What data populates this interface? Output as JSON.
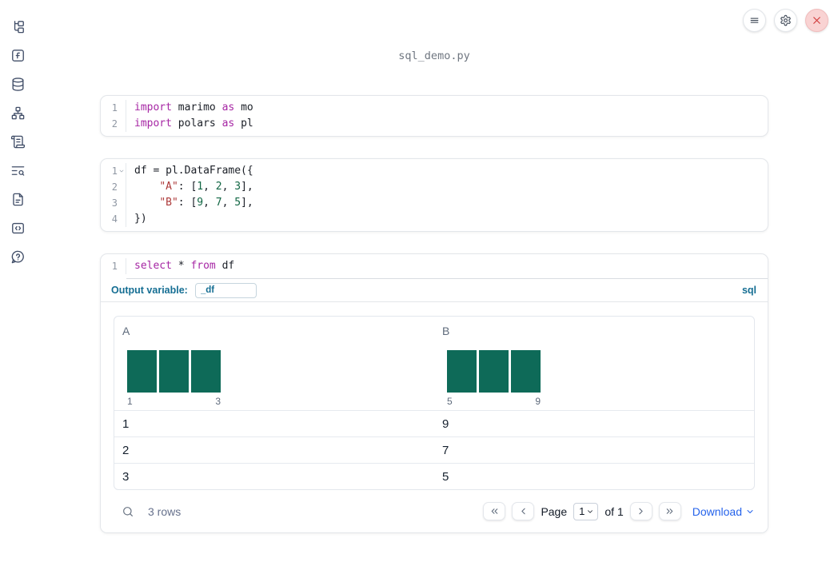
{
  "notebook": {
    "title": "sql_demo.py"
  },
  "colors": {
    "accent_blue": "#156e93",
    "link_blue": "#2563eb",
    "bar_teal": "#0e6a58",
    "keyword_purple": "#a626a4",
    "string_red": "#ad3a3a",
    "number_green": "#116644",
    "close_red": "#d03a3a"
  },
  "sidebar": {
    "icons": [
      "file-tree",
      "function-square",
      "database",
      "dependency-graph",
      "scroll-logs",
      "text-search",
      "document",
      "code-snippets",
      "help-chat"
    ]
  },
  "top_actions": {
    "icons": [
      "menu",
      "settings",
      "close"
    ]
  },
  "cells": {
    "imports": {
      "lines": [
        {
          "num": "1",
          "tokens": [
            {
              "t": "kw",
              "v": "import"
            },
            {
              "t": "pl",
              "v": " marimo "
            },
            {
              "t": "kw",
              "v": "as"
            },
            {
              "t": "pl",
              "v": " mo"
            }
          ]
        },
        {
          "num": "2",
          "tokens": [
            {
              "t": "kw",
              "v": "import"
            },
            {
              "t": "pl",
              "v": " polars "
            },
            {
              "t": "kw",
              "v": "as"
            },
            {
              "t": "pl",
              "v": " pl"
            }
          ]
        }
      ]
    },
    "dataframe": {
      "lines": [
        {
          "num": "1",
          "fold": true,
          "tokens": [
            {
              "t": "pl",
              "v": "df = pl.DataFrame({"
            }
          ]
        },
        {
          "num": "2",
          "tokens": [
            {
              "t": "pl",
              "v": "    "
            },
            {
              "t": "str",
              "v": "\"A\""
            },
            {
              "t": "pl",
              "v": ": ["
            },
            {
              "t": "num",
              "v": "1"
            },
            {
              "t": "pl",
              "v": ", "
            },
            {
              "t": "num",
              "v": "2"
            },
            {
              "t": "pl",
              "v": ", "
            },
            {
              "t": "num",
              "v": "3"
            },
            {
              "t": "pl",
              "v": "],"
            }
          ]
        },
        {
          "num": "3",
          "tokens": [
            {
              "t": "pl",
              "v": "    "
            },
            {
              "t": "str",
              "v": "\"B\""
            },
            {
              "t": "pl",
              "v": ": ["
            },
            {
              "t": "num",
              "v": "9"
            },
            {
              "t": "pl",
              "v": ", "
            },
            {
              "t": "num",
              "v": "7"
            },
            {
              "t": "pl",
              "v": ", "
            },
            {
              "t": "num",
              "v": "5"
            },
            {
              "t": "pl",
              "v": "],"
            }
          ]
        },
        {
          "num": "4",
          "tokens": [
            {
              "t": "pl",
              "v": "})"
            }
          ]
        }
      ]
    },
    "sql": {
      "lines": [
        {
          "num": "1",
          "tokens": [
            {
              "t": "kw",
              "v": "select"
            },
            {
              "t": "pl",
              "v": " * "
            },
            {
              "t": "kw",
              "v": "from"
            },
            {
              "t": "pl",
              "v": " df"
            }
          ]
        }
      ],
      "output_variable_label": "Output variable:",
      "output_variable_value": "_df",
      "language_label": "sql"
    }
  },
  "table": {
    "columns": [
      {
        "name": "A",
        "hist": {
          "bars": [
            1,
            1,
            1
          ],
          "min_label": "1",
          "max_label": "3"
        }
      },
      {
        "name": "B",
        "hist": {
          "bars": [
            1,
            1,
            1
          ],
          "min_label": "5",
          "max_label": "9"
        }
      }
    ],
    "rows": [
      [
        "1",
        "9"
      ],
      [
        "2",
        "7"
      ],
      [
        "3",
        "5"
      ]
    ],
    "footer": {
      "row_count_label": "3 rows",
      "page_label": "Page",
      "page_value": "1",
      "of_label": "of 1",
      "download_label": "Download"
    }
  }
}
